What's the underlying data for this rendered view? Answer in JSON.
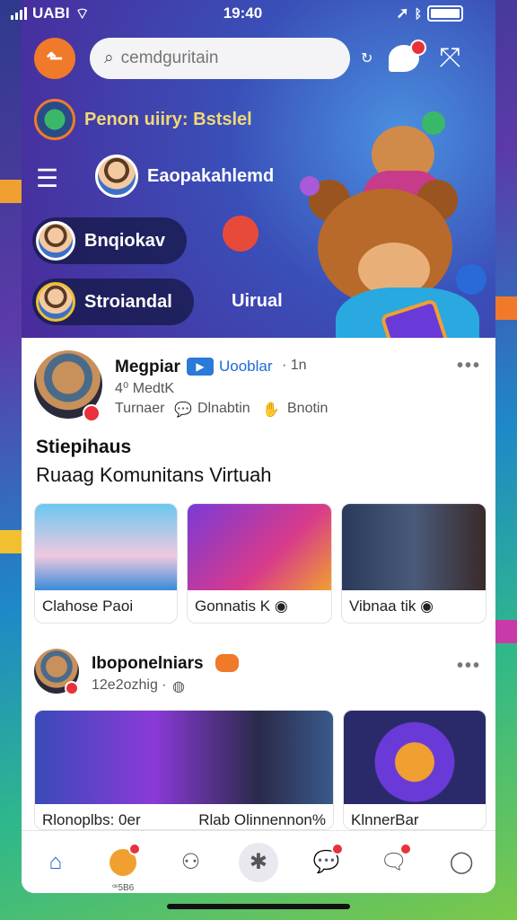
{
  "status": {
    "carrier": "UABI",
    "time": "19:40"
  },
  "header": {
    "logo_glyph": "⬑",
    "search": {
      "value": "",
      "placeholder": "cemdguritain"
    },
    "chat_icon": "chat-bubble-icon",
    "expand_icon": "expand-icon"
  },
  "stories": {
    "title": "Penon uiiry: Bstslel",
    "items": [
      {
        "label": "Eaopakahlemd"
      },
      {
        "label": "Bnqiokav"
      },
      {
        "label": "Stroiandal"
      }
    ],
    "extra_label": "Uirual"
  },
  "posts": [
    {
      "author": "Megpiar",
      "tag": "Uooblar",
      "time": "· 1n",
      "sub": "4⁰ MedtK",
      "actions": [
        "Turnaer",
        "Dlnabtin",
        "Bnotin"
      ],
      "title": "Stiepihaus",
      "subtitle": "Ruaag Komunitans Virtuah",
      "media": [
        {
          "caption": "Clahose Paoi"
        },
        {
          "caption": "Gonnatis K"
        },
        {
          "caption": "Vibnaa tik"
        }
      ]
    },
    {
      "author": "Iboponelniars",
      "time": "12e2ozhig ·",
      "media": [
        {
          "caption": "Rlonoplbs: 0er"
        },
        {
          "caption": "Rlab Olinnennon%"
        },
        {
          "caption": "KlnnerBar"
        }
      ]
    }
  ],
  "tabbar": {
    "items": [
      "home-icon",
      "badge-icon",
      "people-icon",
      "asterisk-icon",
      "chat-icon",
      "messenger-icon",
      "profile-icon"
    ],
    "badge_label": "ꟹ5B6"
  },
  "colors": {
    "accent": "#1e6ad8",
    "notification": "#e8313a",
    "logo": "#f07a2a"
  }
}
